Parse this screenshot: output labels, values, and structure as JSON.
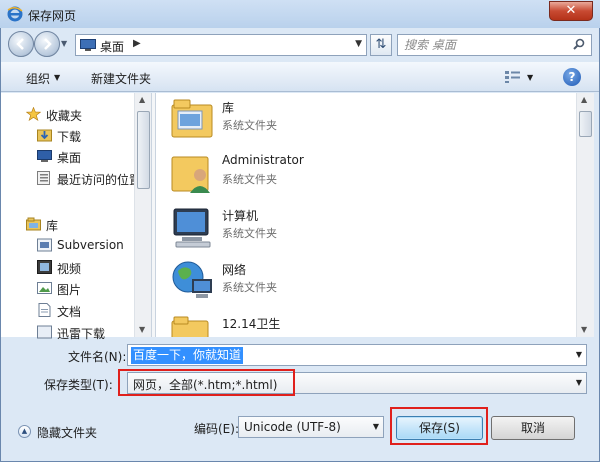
{
  "window": {
    "title": "保存网页",
    "close_label": "✕"
  },
  "address": {
    "location": "桌面",
    "search_placeholder": "搜索 桌面"
  },
  "toolbar": {
    "organize": "组织",
    "new_folder": "新建文件夹",
    "help": "?"
  },
  "sidebar": {
    "favorites": {
      "label": "收藏夹",
      "items": [
        {
          "label": "下载",
          "icon": "download-folder-icon"
        },
        {
          "label": "桌面",
          "icon": "desktop-icon"
        },
        {
          "label": "最近访问的位置",
          "icon": "recent-places-icon"
        }
      ]
    },
    "libraries": {
      "label": "库",
      "items": [
        {
          "label": "Subversion",
          "icon": "subversion-icon"
        },
        {
          "label": "视频",
          "icon": "video-icon"
        },
        {
          "label": "图片",
          "icon": "pictures-icon"
        },
        {
          "label": "文档",
          "icon": "documents-icon"
        },
        {
          "label": "迅雷下载",
          "icon": "thunder-download-icon"
        }
      ]
    }
  },
  "files": [
    {
      "name": "库",
      "type": "系统文件夹",
      "icon": "library-folder-icon"
    },
    {
      "name": "Administrator",
      "type": "系统文件夹",
      "icon": "user-folder-icon"
    },
    {
      "name": "计算机",
      "type": "系统文件夹",
      "icon": "computer-icon"
    },
    {
      "name": "网络",
      "type": "系统文件夹",
      "icon": "network-icon"
    },
    {
      "name": "12.14卫生",
      "type": "",
      "icon": "folder-icon"
    }
  ],
  "form": {
    "filename_label": "文件名(N):",
    "filename_value": "百度一下，你就知道",
    "savetype_label": "保存类型(T):",
    "savetype_value": "网页，全部(*.htm;*.html)",
    "encoding_label": "编码(E):",
    "encoding_value": "Unicode (UTF-8)",
    "hide_folders": "隐藏文件夹",
    "save_button": "保存(S)",
    "cancel_button": "取消"
  },
  "colors": {
    "highlight_box": "#e0201c",
    "selection": "#3390ff"
  }
}
